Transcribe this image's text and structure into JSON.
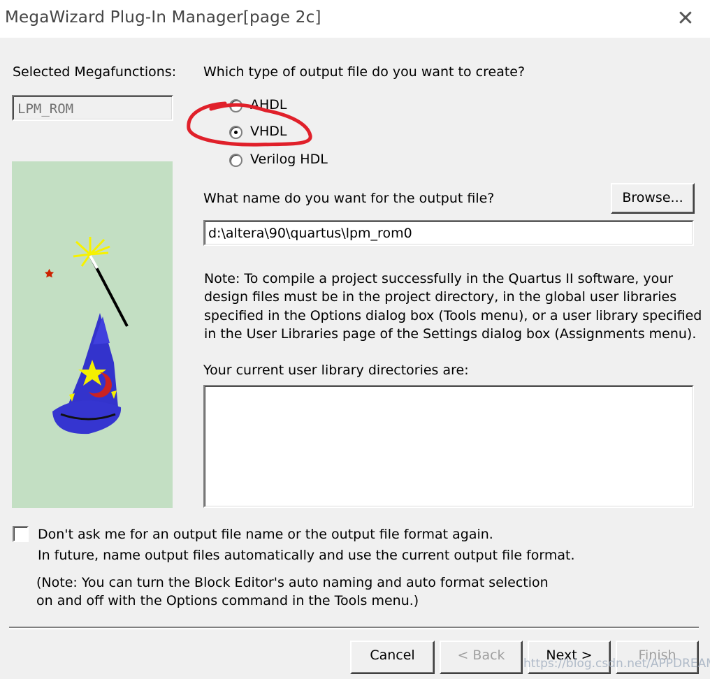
{
  "window": {
    "title": "MegaWizard Plug-In Manager[page 2c]",
    "close_glyph": "✕"
  },
  "left": {
    "selected_label": "Selected Megafunctions:",
    "selected_value": "LPM_ROM"
  },
  "output_type": {
    "question": "Which type of output file do you want to create?",
    "options": [
      {
        "label": "AHDL",
        "selected": false
      },
      {
        "label": "VHDL",
        "selected": true
      },
      {
        "label": "Verilog HDL",
        "selected": false
      }
    ]
  },
  "output_file": {
    "question": "What name do you want for the output file?",
    "browse_label": "Browse...",
    "value": "d:\\altera\\90\\quartus\\lpm_rom0"
  },
  "note": {
    "lines": [
      "Note: To compile a project successfully in the Quartus II software, your",
      "design files must be in the project directory, in the global user libraries",
      "specified in the Options dialog box (Tools menu), or a user library specified",
      "in the User Libraries page of the Settings dialog box (Assignments menu)."
    ]
  },
  "libraries": {
    "label": "Your current user library directories are:",
    "items": []
  },
  "dont_ask": {
    "checked": false,
    "line1": "Don't ask me for an output file name or the output file format again.",
    "line2": "In future, name output files automatically and use the current output file format.",
    "note1": "(Note: You can turn the Block Editor's auto naming and auto format selection",
    "note2": "on and off with the Options command in the Tools menu.)"
  },
  "buttons": {
    "cancel": "Cancel",
    "back": "< Back",
    "next": "Next >",
    "finish": "Finish"
  },
  "watermark": "https://blog.csdn.net/APPDREAMER",
  "colors": {
    "dialog_bg": "#f0f0f0",
    "art_bg": "#c3dfc3",
    "annotation": "#e0202a"
  },
  "icons": {
    "wizard_art": "wizard-hat-and-wand",
    "annotation": "red-hand-drawn-circle"
  }
}
